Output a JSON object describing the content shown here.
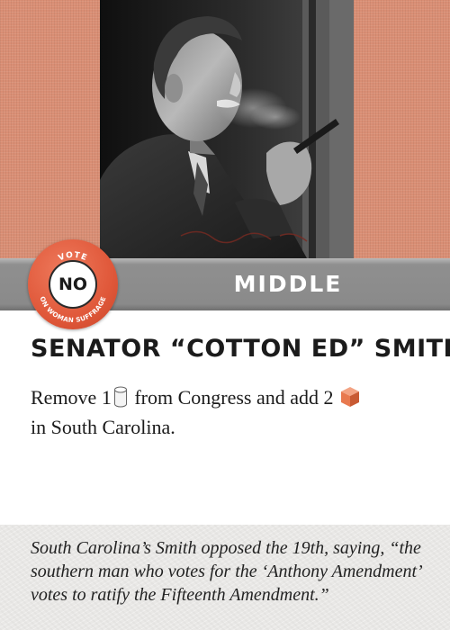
{
  "card": {
    "vote": {
      "top_text": "VOTE",
      "value": "NO",
      "bottom_text": "ON WOMAN SUFFRAGE"
    },
    "region": "MIDDLE",
    "title": "SENATOR “COTTON ED” SMITH",
    "rules": {
      "part1": "Remove 1",
      "part2": " from Congress and add 2 ",
      "part3": "in South Carolina."
    },
    "flavor": "South Carolina’s Smith opposed the 19th, saying, “the southern man who votes for the ‘Anthony Amendment’ votes to ratify the Fifteenth Amendment.”",
    "icons": {
      "congress_piece": "cylinder-icon",
      "state_cube": "cube-icon"
    },
    "colors": {
      "top_band": "#d98e74",
      "badge": "#e0583a",
      "stripe": "#8a8a8a",
      "cube": "#e8794f"
    }
  }
}
